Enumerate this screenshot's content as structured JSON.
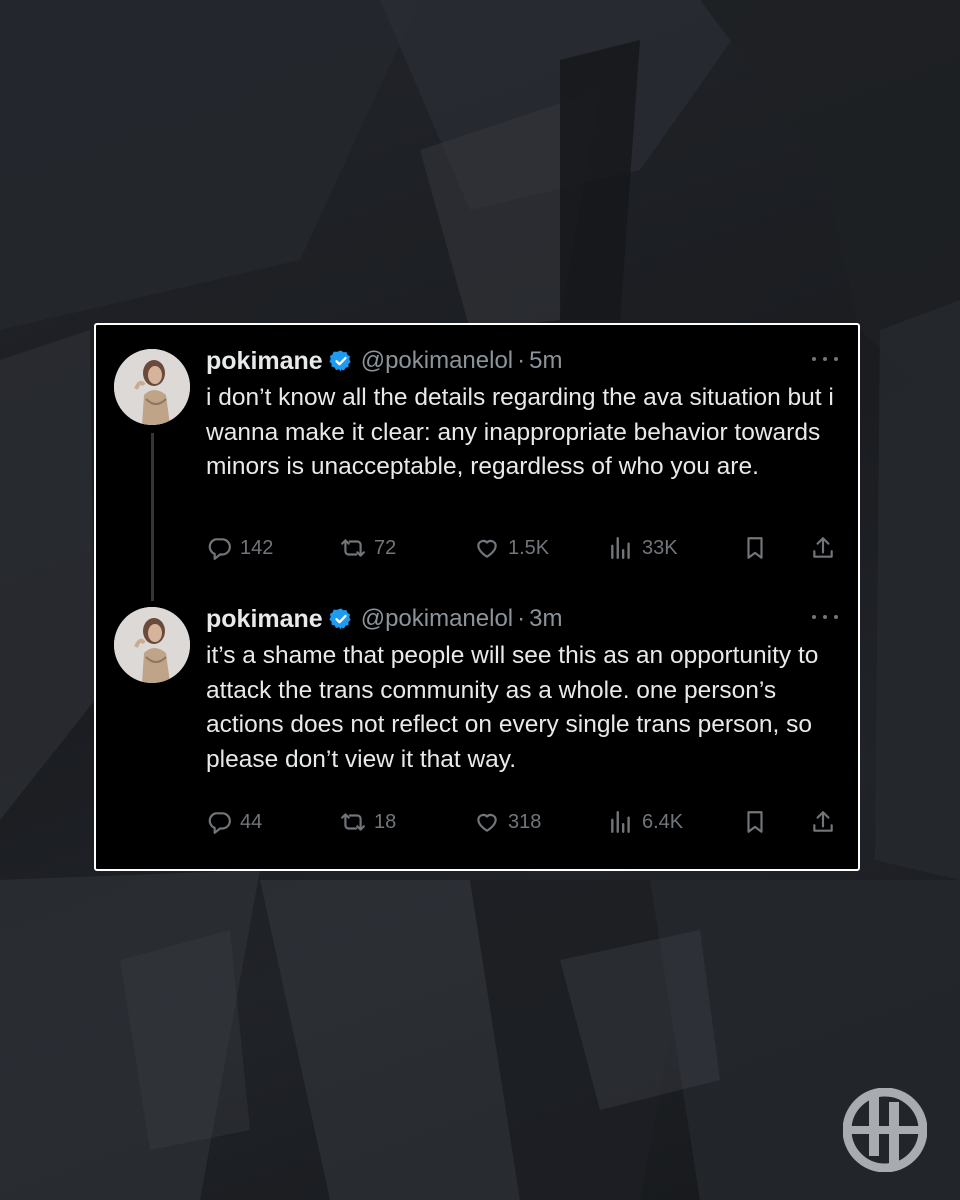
{
  "tweets": [
    {
      "name": "pokimane",
      "handle": "@pokimanelol",
      "separator": "·",
      "time": "5m",
      "text": "i don’t know all the details regarding the ava situation but i wanna make it clear: any inappropriate behavior towards minors is unacceptable, regardless of who you are.",
      "replies": "142",
      "reposts": "72",
      "likes": "1.5K",
      "views": "33K"
    },
    {
      "name": "pokimane",
      "handle": "@pokimanelol",
      "separator": "·",
      "time": "3m",
      "text": "it’s a shame that people will see this as an opportunity to attack the trans community as a whole. one person’s actions does not reflect on every single trans person, so please don’t view it that way.",
      "replies": "44",
      "reposts": "18",
      "likes": "318",
      "views": "6.4K"
    }
  ],
  "icons": {
    "verified": "verified-badge-icon",
    "more": "more-dots-icon",
    "reply": "reply-icon",
    "repost": "repost-icon",
    "like": "heart-icon",
    "views": "views-chart-icon",
    "bookmark": "bookmark-icon",
    "share": "share-icon",
    "watermark": "logo-watermark-icon"
  },
  "colors": {
    "card_bg": "#000000",
    "text_primary": "#e7e9ea",
    "text_secondary": "#71767b",
    "verified_blue": "#1d9bf0",
    "background": "#1b1d21"
  }
}
